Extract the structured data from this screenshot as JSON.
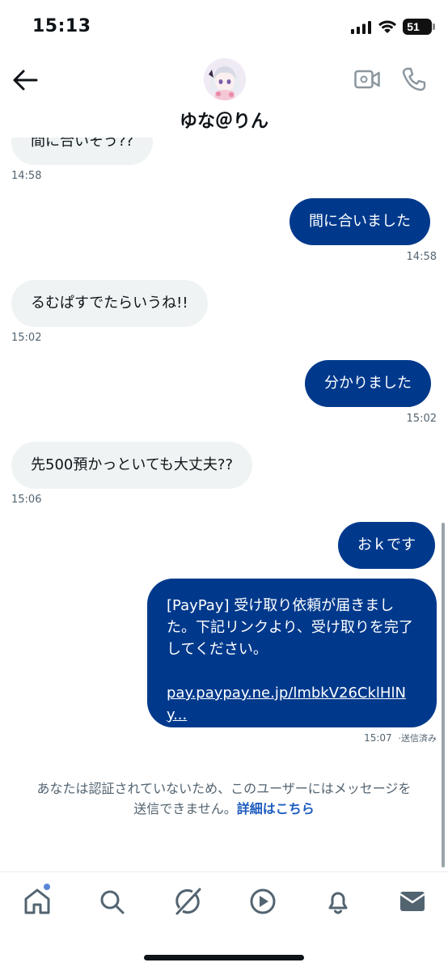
{
  "status_bar": {
    "time": "15:13",
    "battery": "51"
  },
  "header": {
    "contact_name": "ゆな＠りん"
  },
  "messages": [
    {
      "text": "間に合いそう??",
      "time": "14:58"
    },
    {
      "text": "間に合いました",
      "time": "14:58"
    },
    {
      "text": "るむぱすでたらいうね!!",
      "time": "15:02"
    },
    {
      "text": "分かりました",
      "time": "15:02"
    },
    {
      "text": "先500預かっといても大丈夫??",
      "time": "15:06"
    },
    {
      "text": "おｋです"
    }
  ],
  "paypay_message": {
    "text": "[PayPay] 受け取り依頼が届きました。下記リンクより、受け取りを完了してください。",
    "link": "pay.paypay.ne.jp/lmbkV26CklHlNy...",
    "time": "15:07",
    "status": "·送信済み"
  },
  "notice": {
    "line1": "あなたは認証されていないため、このユーザーにはメッセージを",
    "line2": "送信できません。",
    "link": "詳細はこちら"
  },
  "icons": {
    "nav": [
      "home-icon",
      "search-icon",
      "grok-icon",
      "video-icon",
      "bell-icon",
      "mail-icon"
    ],
    "header": [
      "back-arrow-icon",
      "video-call-icon",
      "phone-icon"
    ]
  },
  "colors": {
    "outgoing_bubble": "#00398c",
    "incoming_bubble": "#eff3f4",
    "link": "#1d5bbf"
  }
}
